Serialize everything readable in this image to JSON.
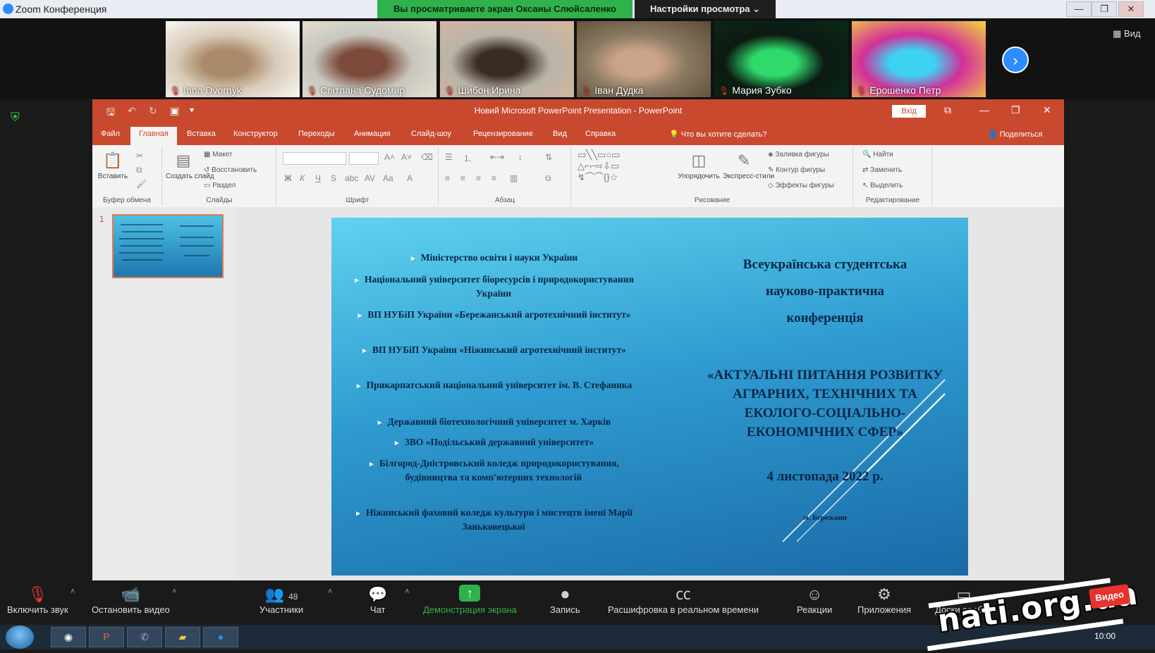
{
  "zoom": {
    "window_title": "Zoom Конференция",
    "viewing_banner": "Вы просматриваете экран Оксаны Слюйсаленко",
    "view_options": "Настройки просмотра ⌄",
    "window_buttons": {
      "minimize": "—",
      "maximize": "❐",
      "close": "✕"
    },
    "grid_view": "▦ Вид",
    "next_page": "›"
  },
  "participants": [
    {
      "name": "Inna Dvornyk",
      "colors": [
        "#d9cbb8",
        "#a98a6a",
        "#ffffff"
      ]
    },
    {
      "name": "Світлана Судомир",
      "colors": [
        "#c8c6bd",
        "#7b4a3a",
        "#e8e3d6"
      ]
    },
    {
      "name": "Шибон Ирина",
      "colors": [
        "#b9b4a8",
        "#3a2b24",
        "#d8b69e"
      ]
    },
    {
      "name": "Іван Дудка",
      "colors": [
        "#8a7a62",
        "#caa389",
        "#5b4a36"
      ]
    },
    {
      "name": "Мария Зубко",
      "colors": [
        "#0c1a12",
        "#2fd96a",
        "#0a2a18"
      ]
    },
    {
      "name": "Ерошенко Петр",
      "colors": [
        "#d22f9a",
        "#3dd2f1",
        "#f4d83a"
      ]
    }
  ],
  "powerpoint": {
    "title": "Новий Microsoft PowerPoint Presentation - PowerPoint",
    "signin": "Вхід",
    "window_buttons": {
      "ribbon_options": "⧉",
      "minimize": "—",
      "maximize": "❐",
      "close": "✕"
    },
    "quick_access": {
      "save": "🖫",
      "undo": "↶",
      "redo": "↻",
      "present": "▣",
      "customize": "▾"
    },
    "tabs": [
      "Файл",
      "Главная",
      "Вставка",
      "Конструктор",
      "Переходы",
      "Анимация",
      "Слайд-шоу",
      "Рецензирование",
      "Вид",
      "Справка"
    ],
    "active_tab": "Главная",
    "tell_me": "Что вы хотите сделать?",
    "share": "Поделиться",
    "ribbon": {
      "clipboard": {
        "label": "Буфер обмена",
        "paste": "Вставить"
      },
      "slides": {
        "label": "Слайды",
        "new_slide": "Создать слайд",
        "layout": "Макет",
        "reset": "Восстановить",
        "section": "Раздел"
      },
      "font": {
        "label": "Шрифт"
      },
      "paragraph": {
        "label": "Абзац"
      },
      "drawing": {
        "label": "Рисование",
        "arrange": "Упорядочить",
        "quick_styles": "Экспресс-стили",
        "shape_fill": "Заливка фигуры",
        "shape_outline": "Контур фигуры",
        "shape_effects": "Эффекты фигуры"
      },
      "editing": {
        "label": "Редактирование",
        "find": "Найти",
        "replace": "Заменить",
        "select": "Выделить"
      }
    },
    "slide_number": "1"
  },
  "slide": {
    "organizations": [
      "Міністерство освіти і науки України",
      "Національний університет біоресурсів і природокористування України",
      "ВП НУБіП України «Бережанський агротехнічний інститут»",
      "ВП НУБіП України «Ніжинський агротехнічний інститут»",
      "Прикарпатський національний університет ім. В. Стефаника",
      "Державний біотехнологічний університет м. Харків",
      "ЗВО «Подільський державний університет»",
      "Білгород-Дністровський коледж природокористування, будівництва та комп'ютерних технологій",
      "Ніжинський фаховий коледж культури і мистецтв імені Марії Заньковецької"
    ],
    "conference": {
      "line1": "Всеукраїнська студентська",
      "line2": "науково-практична",
      "line3": "конференція",
      "topic": "«АКТУАЛЬНІ ПИТАННЯ РОЗВИТКУ АГРАРНИХ, ТЕХНІЧНИХ ТА ЕКОЛОГО-СОЦІАЛЬНО-ЕКОНОМІЧНИХ СФЕР»",
      "date": "4 листопада 2022 р.",
      "city": "м. Бережани"
    }
  },
  "toolbar": {
    "mute": "Включить звук",
    "video": "Остановить видео",
    "participants": "Участники",
    "participants_count": "48",
    "chat": "Чат",
    "share": "Демонстрация экрана",
    "record": "Запись",
    "transcription": "Расшифровка в реальном времени",
    "reactions": "Реакции",
    "apps": "Приложения",
    "whiteboard": "Доски сообщ."
  },
  "taskbar": {
    "apps": [
      "Chrome",
      "PowerPoint",
      "Viber",
      "Explorer",
      "Zoom"
    ],
    "clock": "10:00"
  },
  "watermark": {
    "text": "nati.org.ua",
    "badge": "Видео"
  },
  "colors": {
    "ppt_accent": "#c9492f",
    "zoom_green": "#2fb24c",
    "zoom_blue": "#2d8cff",
    "slide_text": "#062647"
  }
}
